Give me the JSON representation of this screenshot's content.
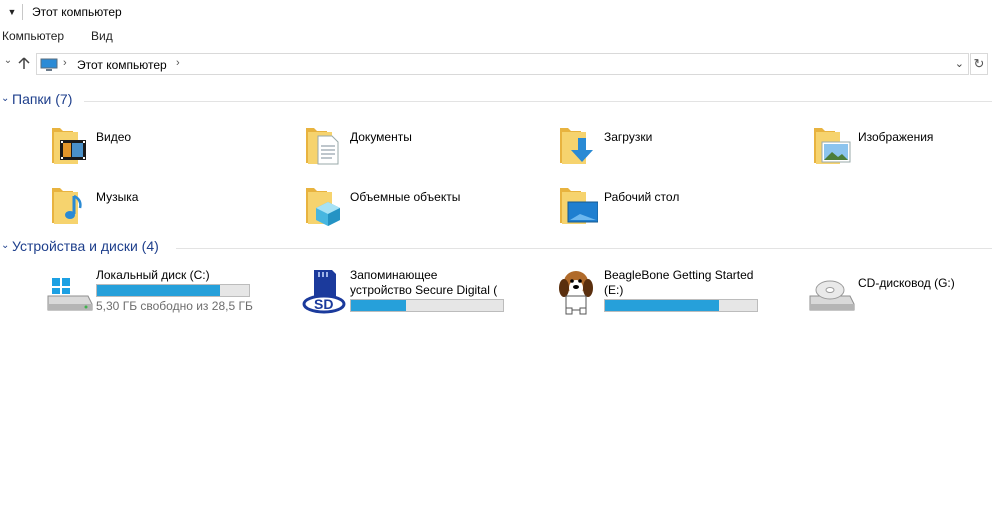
{
  "window": {
    "title": "Этот компьютер",
    "quick_access_icon": "chevron-down-icon"
  },
  "ribbon": {
    "tabs": [
      "Компьютер",
      "Вид"
    ]
  },
  "address": {
    "nav_up_icon": "arrow-up-icon",
    "path": "Этот компьютер",
    "pc_icon": "computer-icon",
    "refresh_icon": "refresh-icon"
  },
  "colors": {
    "accent": "#1e3f8c",
    "bar_fill": "#26a0da",
    "bar_bg": "#e6e6e6",
    "folder": "#f2cc66"
  },
  "folders": {
    "header": "Папки (7)",
    "items": [
      {
        "label": "Видео",
        "icon": "videos-folder-icon"
      },
      {
        "label": "Документы",
        "icon": "documents-folder-icon"
      },
      {
        "label": "Загрузки",
        "icon": "downloads-folder-icon"
      },
      {
        "label": "Изображения",
        "icon": "pictures-folder-icon"
      },
      {
        "label": "Музыка",
        "icon": "music-folder-icon"
      },
      {
        "label": "Объемные объекты",
        "icon": "3d-objects-folder-icon"
      },
      {
        "label": "Рабочий стол",
        "icon": "desktop-folder-icon"
      }
    ]
  },
  "devices": {
    "header": "Устройства и диски (4)",
    "items": [
      {
        "label": "Локальный диск (C:)",
        "icon": "windows-drive-icon",
        "usage_fraction": 0.81,
        "detail": "5,30 ГБ свободно из 28,5 ГБ"
      },
      {
        "label_line1": "Запоминающее",
        "label_line2": "устройство Secure Digital (",
        "icon": "sd-card-icon",
        "usage_fraction": 0.36
      },
      {
        "label_line1": "BeagleBone Getting Started",
        "label_line2": "(E:)",
        "icon": "beagle-dog-icon",
        "usage_fraction": 0.75
      },
      {
        "label": "CD-дисковод (G:)",
        "icon": "cd-drive-icon"
      }
    ]
  }
}
